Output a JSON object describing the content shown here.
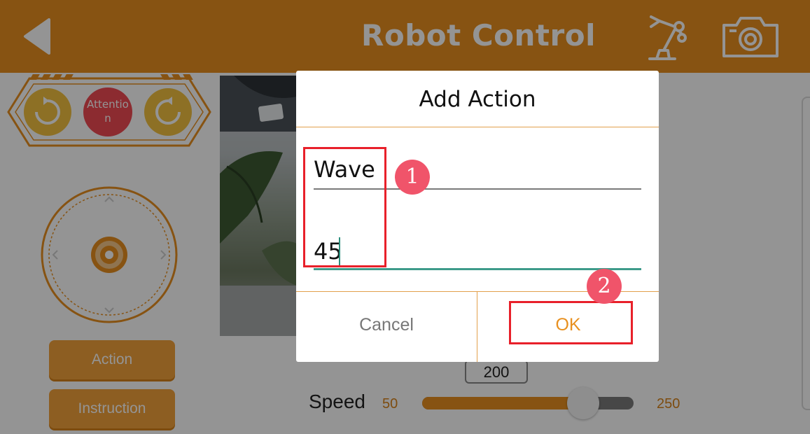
{
  "header": {
    "title": "Robot Control",
    "back_icon": "back-arrow-icon",
    "arm_icon": "robot-arm-icon",
    "camera_icon": "camera-icon"
  },
  "controls": {
    "attention_label": "Attentio\nn",
    "rotate_left_icon": "rotate-left-icon",
    "rotate_right_icon": "rotate-right-icon",
    "joystick_icon": "robot-joystick-icon"
  },
  "side_buttons": {
    "action": "Action",
    "instruction": "Instruction"
  },
  "speed": {
    "label": "Speed",
    "value": "200",
    "min": "50",
    "max": "250",
    "current": 200
  },
  "dialog": {
    "title": "Add Action",
    "name_value": "Wave",
    "time_value": "45",
    "cancel": "Cancel",
    "ok": "OK"
  },
  "annotations": {
    "marker_1": "1",
    "marker_2": "2"
  },
  "colors": {
    "brand": "#e8901f",
    "accent_teal": "#3e9b8a",
    "highlight_red": "#e8202a",
    "marker_pink": "#f0546a"
  }
}
